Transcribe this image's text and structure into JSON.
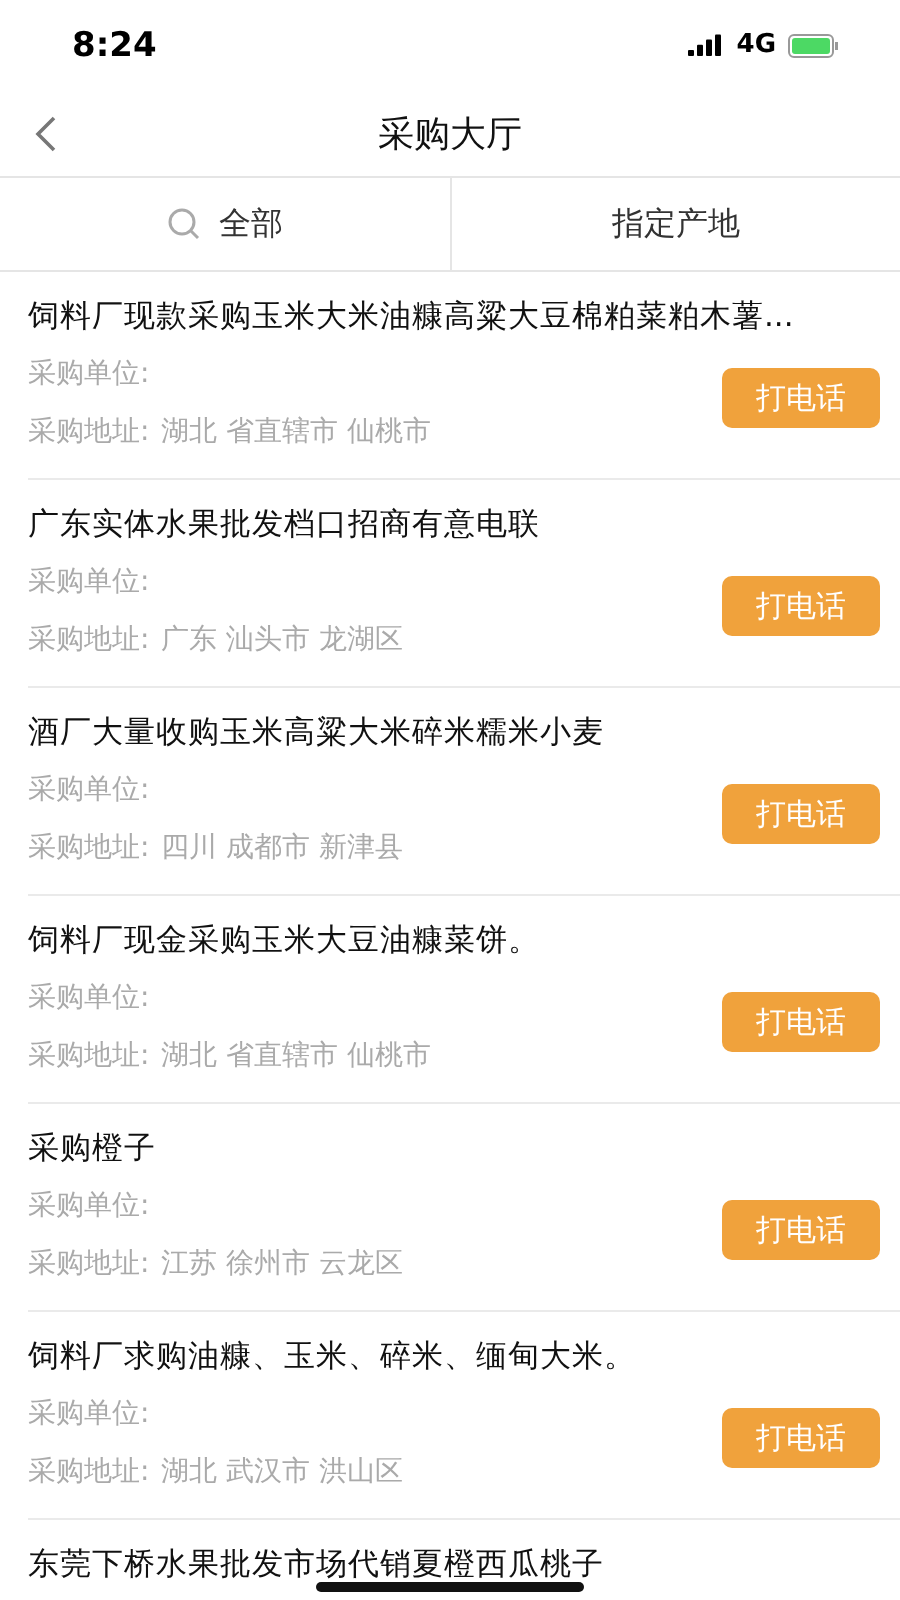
{
  "status_bar": {
    "time": "8:24",
    "network": "4G"
  },
  "nav": {
    "title": "采购大厅"
  },
  "filters": [
    {
      "label": "全部",
      "kind": "search"
    },
    {
      "label": "指定产地",
      "kind": "plain"
    }
  ],
  "listings": [
    {
      "title": "饲料厂现款采购玉米大米油糠高粱大豆棉粕菜粕木薯...",
      "unit_label": "采购单位:",
      "address_label": "采购地址:",
      "address": "湖北 省直辖市 仙桃市",
      "button": "打电话"
    },
    {
      "title": "广东实体水果批发档口招商有意电联",
      "unit_label": "采购单位:",
      "address_label": "采购地址:",
      "address": "广东 汕头市 龙湖区",
      "button": "打电话"
    },
    {
      "title": "酒厂大量收购玉米高粱大米碎米糯米小麦",
      "unit_label": "采购单位:",
      "address_label": "采购地址:",
      "address": "四川 成都市 新津县",
      "button": "打电话"
    },
    {
      "title": "饲料厂现金采购玉米大豆油糠菜饼。",
      "unit_label": "采购单位:",
      "address_label": "采购地址:",
      "address": "湖北 省直辖市 仙桃市",
      "button": "打电话"
    },
    {
      "title": "采购橙子",
      "unit_label": "采购单位:",
      "address_label": "采购地址:",
      "address": "江苏 徐州市 云龙区",
      "button": "打电话"
    },
    {
      "title": "饲料厂求购油糠、玉米、碎米、缅甸大米。",
      "unit_label": "采购单位:",
      "address_label": "采购地址:",
      "address": "湖北 武汉市 洪山区",
      "button": "打电话"
    },
    {
      "title": "东莞下桥水果批发市场代销夏橙西瓜桃子"
    }
  ]
}
